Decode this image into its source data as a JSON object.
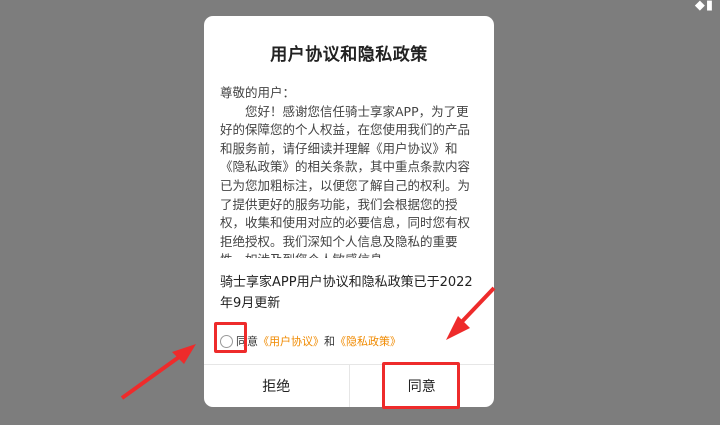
{
  "dialog": {
    "title": "用户协议和隐私政策",
    "greeting": "尊敬的用户：",
    "body": "您好！感谢您信任骑士享家APP，为了更好的保障您的个人权益，在您使用我们的产品和服务前，请仔细读并理解《用户协议》和《隐私政策》的相关条款，其中重点条款内容已为您加粗标注，以便您了解自己的权利。为了提供更好的服务功能，我们会根据您的授权，收集和使用对应的必要信息，同时您有权拒绝授权。我们深知个人信息及隐私的重要性，如涉及到您个人敏感信息",
    "update_note": "骑士享家APP用户协议和隐私政策已于2022年9月更新",
    "agree": {
      "prefix": "同意",
      "user_agreement_link": "《用户协议》",
      "and": "和",
      "privacy_policy_link": "《隐私政策》"
    },
    "reject_label": "拒绝",
    "accept_label": "同意"
  },
  "colors": {
    "overlay": "#7d7d7d",
    "link": "#f08a00",
    "highlight": "#ee2b2b"
  },
  "icons": {
    "top_right": "status-icon"
  }
}
